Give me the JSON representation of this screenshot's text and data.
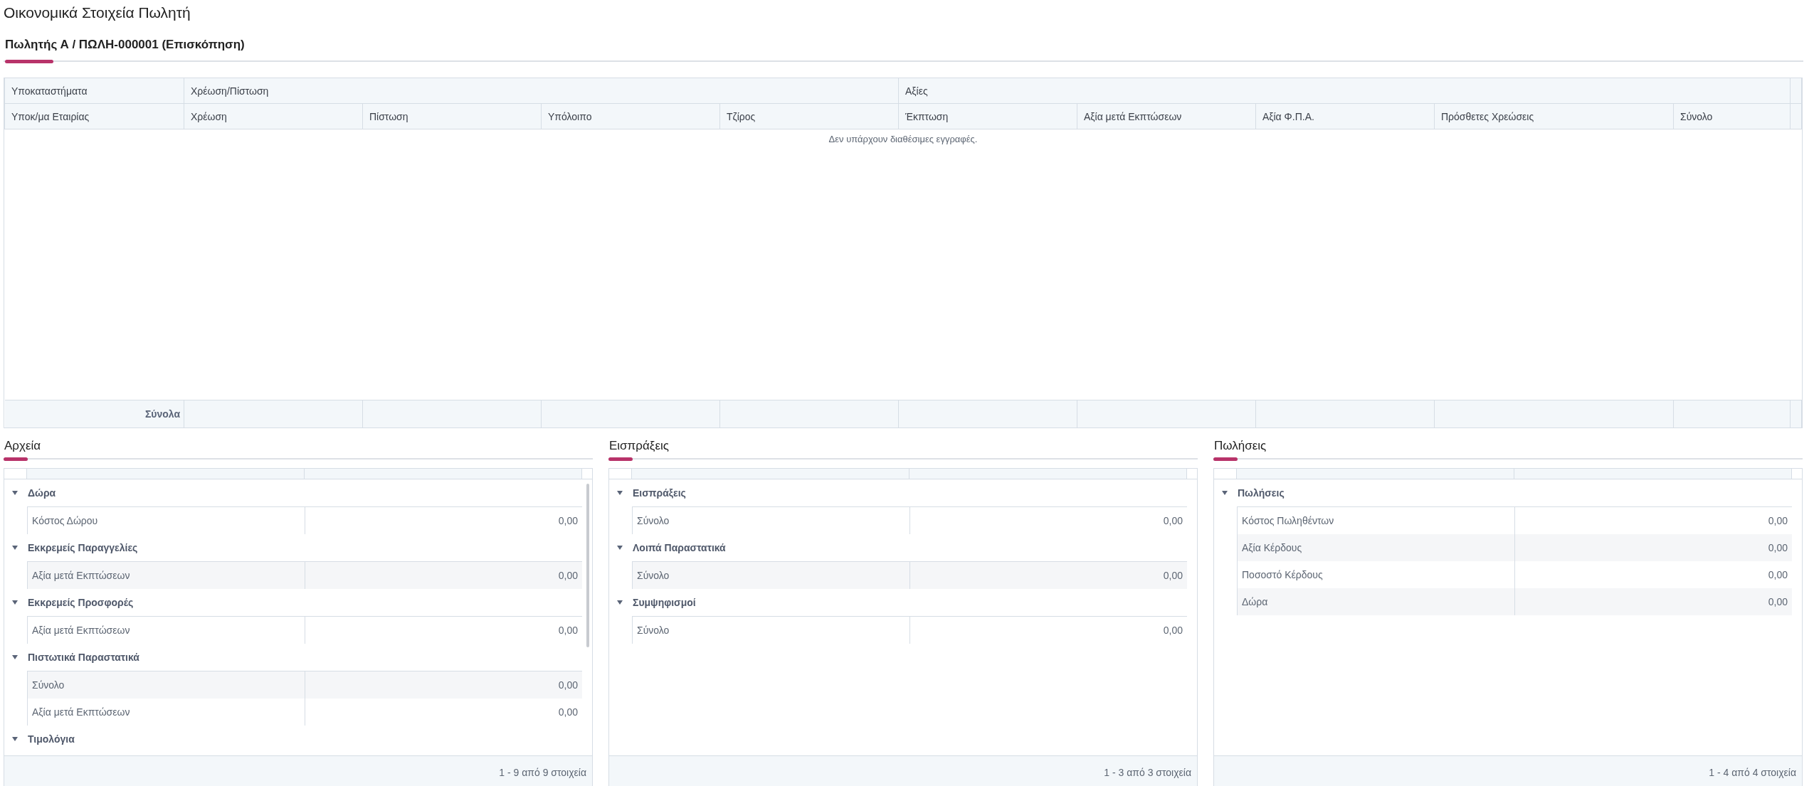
{
  "page_title": "Οικονομικά Στοιχεία Πωλητή",
  "tabs": [
    {
      "label": "Πωλητής Α / ΠΩΛΗ-000001 (Επισκόπηση)",
      "selected": true
    }
  ],
  "table": {
    "column_groups": [
      {
        "label": "Υποκαταστήματα",
        "columns": [
          "Υποκ/μα Εταιρίας"
        ]
      },
      {
        "label": "Χρέωση/Πίστωση",
        "columns": [
          "Χρέωση",
          "Πίστωση",
          "Υπόλοιπο",
          "Τζίρος"
        ]
      },
      {
        "label": "Αξίες",
        "columns": [
          "Έκπτωση",
          "Αξία μετά Εκπτώσεων",
          "Αξία Φ.Π.Α.",
          "Πρόσθετες Χρεώσεις",
          "Σύνολο"
        ]
      }
    ],
    "empty_message": "Δεν υπάρχουν διαθέσιμες εγγραφές.",
    "totals_label": "Σύνολα"
  },
  "panels": [
    {
      "title": "Αρχεία",
      "scrollable": true,
      "groups": [
        {
          "label": "Δώρα",
          "expanded": true,
          "rows": [
            {
              "label": "Κόστος Δώρου",
              "value": "0,00"
            }
          ]
        },
        {
          "label": "Εκκρεμείς Παραγγελίες",
          "expanded": true,
          "rows": [
            {
              "label": "Αξία μετά Εκπτώσεων",
              "value": "0,00"
            }
          ]
        },
        {
          "label": "Εκκρεμείς Προσφορές",
          "expanded": true,
          "rows": [
            {
              "label": "Αξία μετά Εκπτώσεων",
              "value": "0,00"
            }
          ]
        },
        {
          "label": "Πιστωτικά Παραστατικά",
          "expanded": true,
          "rows": [
            {
              "label": "Σύνολο",
              "value": "0,00"
            },
            {
              "label": "Αξία μετά Εκπτώσεων",
              "value": "0,00"
            }
          ]
        },
        {
          "label": "Τιμολόγια",
          "expanded": true
        }
      ],
      "pager": "1 - 9 από 9 στοιχεία"
    },
    {
      "title": "Εισπράξεις",
      "scrollable": false,
      "groups": [
        {
          "label": "Εισπράξεις",
          "expanded": true,
          "rows": [
            {
              "label": "Σύνολο",
              "value": "0,00"
            }
          ]
        },
        {
          "label": "Λοιπά Παραστατικά",
          "expanded": true,
          "rows": [
            {
              "label": "Σύνολο",
              "value": "0,00"
            }
          ]
        },
        {
          "label": "Συμψηφισμοί",
          "expanded": true,
          "rows": [
            {
              "label": "Σύνολο",
              "value": "0,00"
            }
          ]
        }
      ],
      "pager": "1 - 3 από 3 στοιχεία"
    },
    {
      "title": "Πωλήσεις",
      "scrollable": false,
      "groups": [
        {
          "label": "Πωλήσεις",
          "expanded": true,
          "rows": [
            {
              "label": "Κόστος Πωληθέντων",
              "value": "0,00"
            },
            {
              "label": "Αξία Κέρδους",
              "value": "0,00"
            },
            {
              "label": "Ποσοστό Κέρδους",
              "value": "0,00"
            },
            {
              "label": "Δώρα",
              "value": "0,00"
            }
          ]
        }
      ],
      "pager": "1 - 4 από 4 στοιχεία"
    }
  ]
}
